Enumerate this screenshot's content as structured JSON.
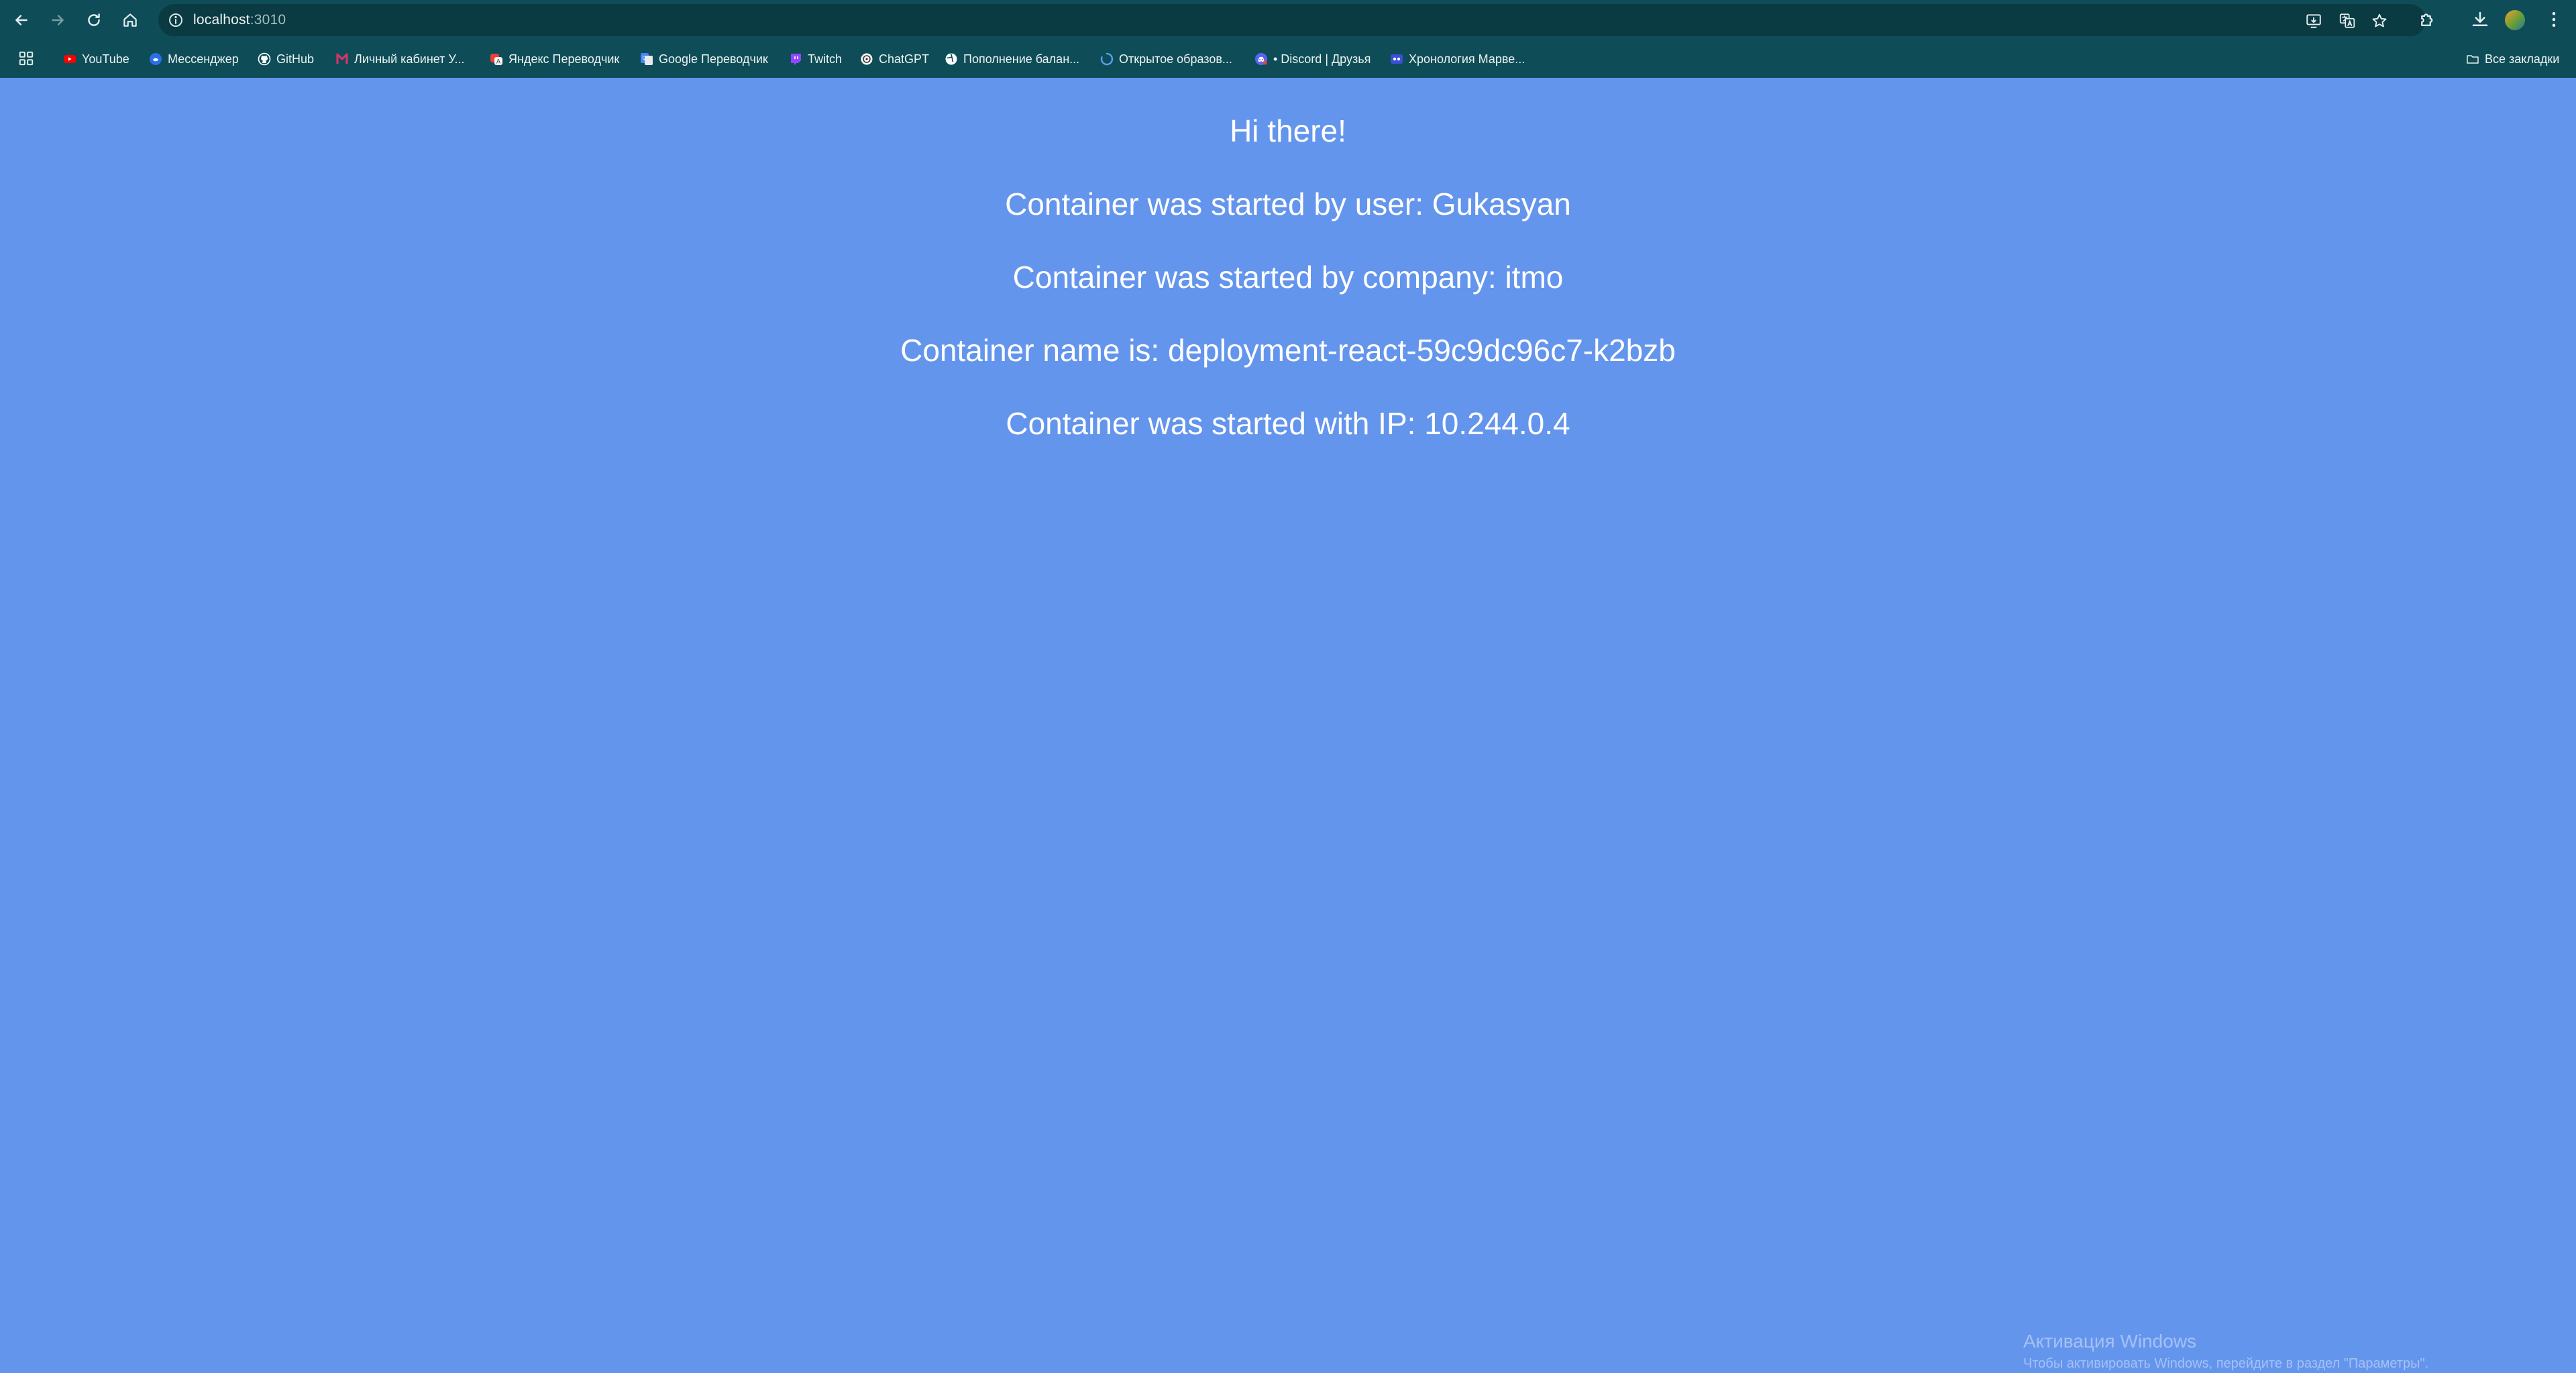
{
  "browser": {
    "url_host": "localhost",
    "url_port": ":3010",
    "toolbar_icons": [
      "back-icon",
      "forward-icon",
      "reload-icon",
      "home-icon",
      "info-icon",
      "install-app-icon",
      "translate-icon",
      "star-icon",
      "extensions-icon",
      "download-icon",
      "avatar",
      "menu-icon"
    ],
    "bookmarks": [
      {
        "label": "YouTube",
        "icon": "youtube-icon",
        "color": "#ff0000"
      },
      {
        "label": "Мессенджер",
        "icon": "messenger-icon",
        "color": "#2a6fe8"
      },
      {
        "label": "GitHub",
        "icon": "github-icon",
        "color": "#ffffff"
      },
      {
        "label": "Личный кабинет У...",
        "icon": "cabinet-icon",
        "color": "#e0336b"
      },
      {
        "label": "Яндекс Переводчик",
        "icon": "yandex-translate-icon",
        "color": "#e8413a"
      },
      {
        "label": "Google Переводчик",
        "icon": "google-translate-icon",
        "color": "#4285f4"
      },
      {
        "label": "Twitch",
        "icon": "twitch-icon",
        "color": "#9146ff"
      },
      {
        "label": "ChatGPT",
        "icon": "chatgpt-icon",
        "color": "#ffffff"
      },
      {
        "label": "Пополнение балан...",
        "icon": "globe-icon",
        "color": "#ffffff"
      },
      {
        "label": "Открытое образов...",
        "icon": "loading-icon",
        "color": "#5aa0f0"
      },
      {
        "label": "• Discord | Друзья",
        "icon": "discord-icon",
        "color": "#5865f2"
      },
      {
        "label": "Хронология Марве...",
        "icon": "marvel-icon",
        "color": "#3a4fd8"
      }
    ],
    "all_bookmarks_label": "Все закладки"
  },
  "content": {
    "greeting": "Hi there!",
    "user_line": "Container was started by user: Gukasyan",
    "company_line": "Container was started by company: itmo",
    "name_line": "Container name is: deployment-react-59c9dc96c7-k2bzb",
    "ip_line": "Container was started with IP: 10.244.0.4"
  },
  "watermark": {
    "title": "Активация Windows",
    "subtitle": "Чтобы активировать Windows, перейдите в раздел \"Параметры\"."
  },
  "colors": {
    "page_background": "#6495ed",
    "browser_chrome": "#0e4d57",
    "text": "#ffffff"
  }
}
